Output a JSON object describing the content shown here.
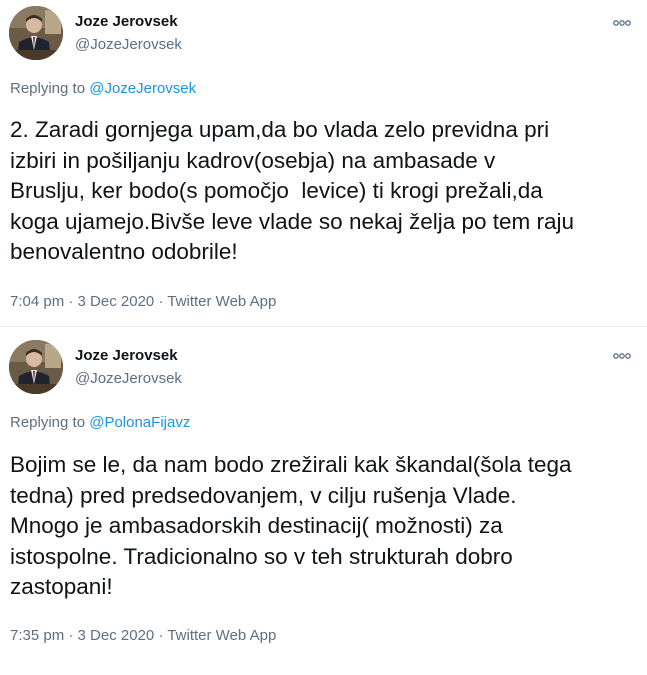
{
  "tweets": [
    {
      "author_name": "Joze Jerovsek",
      "author_handle": "@JozeJerovsek",
      "replying_prefix": "Replying to ",
      "replying_to": "@JozeJerovsek",
      "text": "2. Zaradi gornjega upam,da bo vlada zelo previdna pri\nizbiri in pošiljanju kadrov(osebja) na ambasade v\nBruslju, ker bodo(s pomočjo  levice) ti krogi prežali,da\nkoga ujamejo.Bivše leve vlade so nekaj želja po tem raju\nbenovalentno odobrile!",
      "time": "7:04 pm",
      "date": "3 Dec 2020",
      "source": "Twitter Web App",
      "more_icon": "more-horizontal-icon"
    },
    {
      "author_name": "Joze Jerovsek",
      "author_handle": "@JozeJerovsek",
      "replying_prefix": "Replying to ",
      "replying_to": "@PolonaFijavz",
      "text": "Bojim se le, da nam bodo zrežirali kak škandal(šola tega\ntedna) pred predsedovanjem, v cilju rušenja Vlade.\nMnogo je ambasadorskih destinacij( možnosti) za\nistospolne. Tradicionalno so v teh strukturah dobro\nzastopani!",
      "time": "7:35 pm",
      "date": "3 Dec 2020",
      "source": "Twitter Web App",
      "more_icon": "more-horizontal-icon"
    }
  ],
  "separator": " · ",
  "colors": {
    "text": "#0f1419",
    "secondary": "#5b7083",
    "link": "#1b95e0",
    "divider": "#e6ecf0"
  }
}
